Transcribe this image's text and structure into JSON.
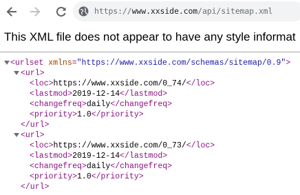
{
  "browser": {
    "url_prefix": "https://",
    "url_domain": "www.xxside.com",
    "url_path": "/api/sitemap.xml",
    "back_icon": "arrow-left-icon",
    "forward_icon": "arrow-right-icon",
    "reload_icon": "reload-icon",
    "site_info_icon": "globe-icon"
  },
  "page": {
    "banner": "This XML file does not appear to have any style informat"
  },
  "xml": {
    "root_open": "<urlset",
    "root_attr_name": "xmlns",
    "root_attr_value": "\"https://www.xxside.com/schemas/sitemap/0.9\"",
    "root_close_bracket": ">",
    "entries": [
      {
        "open": "<url>",
        "loc_open": "<loc>",
        "loc": "https://www.xxside.com/0_74/",
        "loc_close": "</loc>",
        "lastmod_open": "<lastmod>",
        "lastmod": "2019-12-14",
        "lastmod_close": "</lastmod>",
        "changefreq_open": "<changefreq>",
        "changefreq": "daily",
        "changefreq_close": "</changefreq>",
        "priority_open": "<priority>",
        "priority": "1.0",
        "priority_close": "</priority>",
        "close": "</url>"
      },
      {
        "open": "<url>",
        "loc_open": "<loc>",
        "loc": "https://www.xxside.com/0_73/",
        "loc_close": "</loc>",
        "lastmod_open": "<lastmod>",
        "lastmod": "2019-12-14",
        "lastmod_close": "</lastmod>",
        "changefreq_open": "<changefreq>",
        "changefreq": "daily",
        "changefreq_close": "</changefreq>",
        "priority_open": "<priority>",
        "priority": "1.0",
        "priority_close": "</priority>",
        "close": "</url>"
      }
    ]
  },
  "colors": {
    "tag": "#881280",
    "attribute": "#994500",
    "attribute_value": "#1a1aa6",
    "omnibox_bg": "#f1f3f4"
  }
}
